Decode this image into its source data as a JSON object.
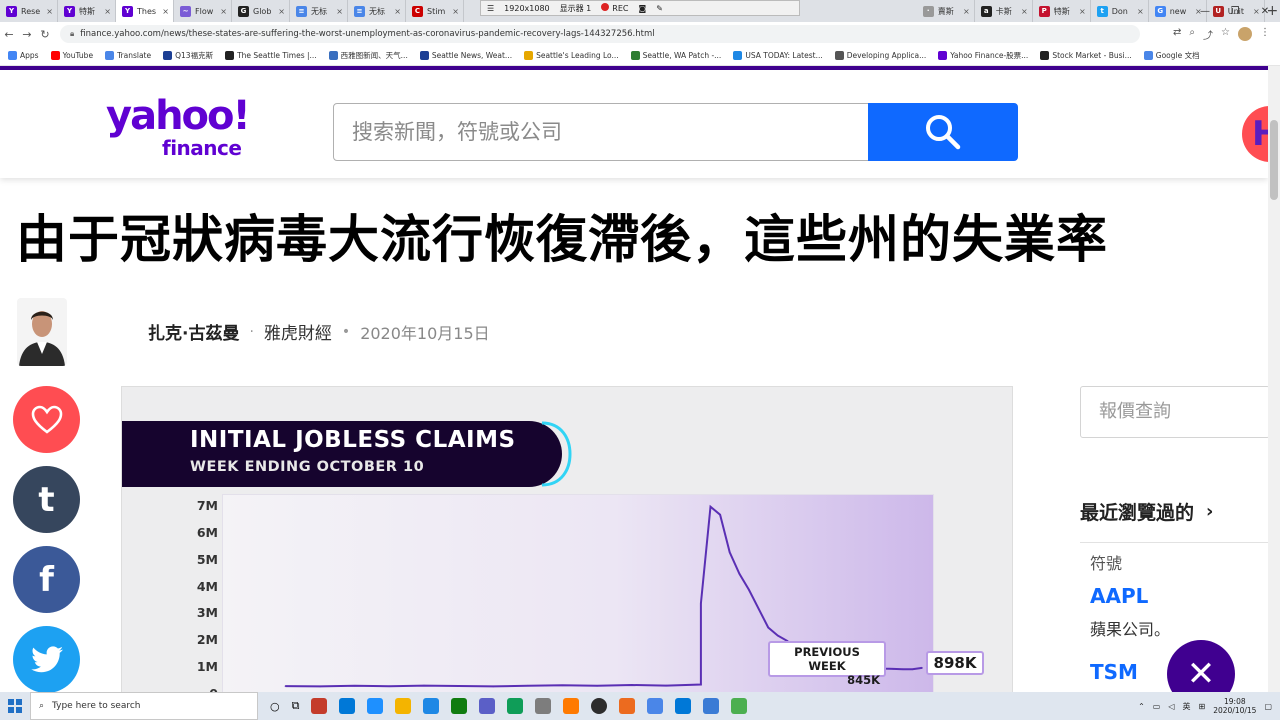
{
  "browser": {
    "tabs": [
      {
        "label": "Rese",
        "color": "#6001d2",
        "glyph": "Y",
        "active": false
      },
      {
        "label": "特斯",
        "color": "#6001d2",
        "glyph": "Y",
        "active": false
      },
      {
        "label": "Thes",
        "color": "#6001d2",
        "glyph": "Y",
        "active": true
      },
      {
        "label": "Flow",
        "color": "#7b5cd6",
        "glyph": "~",
        "active": false
      },
      {
        "label": "Glob",
        "color": "#222222",
        "glyph": "G",
        "active": false
      },
      {
        "label": "无标",
        "color": "#4a86e8",
        "glyph": "≡",
        "active": false
      },
      {
        "label": "无标",
        "color": "#4a86e8",
        "glyph": "≡",
        "active": false
      },
      {
        "label": "Stim",
        "color": "#cc0000",
        "glyph": "C",
        "active": false
      }
    ],
    "tabs_right": [
      {
        "label": "賣斯",
        "color": "#999999",
        "glyph": "·"
      },
      {
        "label": "卡斯",
        "color": "#222222",
        "glyph": "a"
      },
      {
        "label": "特斯",
        "color": "#c4122f",
        "glyph": "P"
      },
      {
        "label": "Don",
        "color": "#1da1f2",
        "glyph": "t"
      },
      {
        "label": "new",
        "color": "#4285f4",
        "glyph": "G"
      },
      {
        "label": "Unit",
        "color": "#b22222",
        "glyph": "U"
      }
    ],
    "recorder": {
      "resolution": "1920x1080",
      "display": "显示器 1",
      "rec_label": "REC"
    },
    "url": "finance.yahoo.com/news/these-states-are-suffering-the-worst-unemployment-as-coronavirus-pandemic-recovery-lags-144327256.html",
    "bookmarks": [
      {
        "label": "Apps",
        "color": "#4285f4"
      },
      {
        "label": "YouTube",
        "color": "#ff0000"
      },
      {
        "label": "Translate",
        "color": "#4a86e8"
      },
      {
        "label": "Q13福克斯",
        "color": "#1c3f94"
      },
      {
        "label": "The Seattle Times |...",
        "color": "#222222"
      },
      {
        "label": "西雅图新闻、天气...",
        "color": "#3a6fbf"
      },
      {
        "label": "Seattle News, Weat...",
        "color": "#1c3f94"
      },
      {
        "label": "Seattle's Leading Lo...",
        "color": "#e6a700"
      },
      {
        "label": "Seattle, WA Patch -...",
        "color": "#2e7d32"
      },
      {
        "label": "USA TODAY: Latest...",
        "color": "#1e88e5"
      },
      {
        "label": "Developing Applica...",
        "color": "#555555"
      },
      {
        "label": "Yahoo Finance-股票...",
        "color": "#6001d2"
      },
      {
        "label": "Stock Market - Busi...",
        "color": "#222222"
      },
      {
        "label": "Google 文档",
        "color": "#4a86e8"
      }
    ]
  },
  "site": {
    "logo_top": "yahoo!",
    "logo_bottom": "finance",
    "search_placeholder": "搜索新聞，符號或公司",
    "brand_color": "#6001d2",
    "search_button_color": "#0f69ff"
  },
  "article": {
    "headline": "由于冠狀病毒大流行恢復滯後，這些州的失業率",
    "author": "扎克·古茲曼",
    "source": "雅虎財經",
    "date": "2020年10月15日"
  },
  "share": {
    "heart_icon": "heart-icon",
    "tumblr_glyph": "t",
    "facebook_glyph": "f",
    "twitter_icon": "twitter-icon"
  },
  "video": {
    "title": "INITIAL JOBLESS CLAIMS",
    "subtitle": "WEEK ENDING OCTOBER 10",
    "previous_week_label": "PREVIOUS WEEK",
    "previous_week_value": "845K",
    "current_value": "898K"
  },
  "chart_data": {
    "type": "line",
    "title": "INITIAL JOBLESS CLAIMS",
    "subtitle": "WEEK ENDING OCTOBER 10",
    "y_ticks": [
      "7M",
      "6M",
      "5M",
      "4M",
      "3M",
      "2M",
      "1M",
      "0"
    ],
    "ylim": [
      0,
      7000000
    ],
    "series": [
      {
        "values": [
          220000,
          210000,
          230000,
          215000,
          240000,
          225000,
          210000,
          235000,
          250000,
          230000,
          260000,
          240000,
          280000,
          3300000,
          6900000,
          6600000,
          5200000,
          4400000,
          3800000,
          3100000,
          2400000,
          2100000,
          1900000,
          1500000,
          1300000,
          1100000,
          1250000,
          1400000,
          1300000,
          1100000,
          900000,
          1000000,
          870000,
          860000,
          850000,
          845000,
          898000
        ]
      }
    ],
    "annotations": [
      {
        "label": "PREVIOUS WEEK",
        "value": "845K"
      },
      {
        "label": "",
        "value": "898K"
      }
    ],
    "grid": false
  },
  "rail": {
    "quote_placeholder": "報價查詢",
    "recent_title": "最近瀏覽過的",
    "symbol_header": "符號",
    "tickers": [
      {
        "symbol": "AAPL",
        "name": "蘋果公司。"
      },
      {
        "symbol": "TSM",
        "name": ""
      }
    ]
  },
  "taskbar": {
    "search_placeholder": "Type here to search",
    "time": "19:08",
    "date": "2020/10/15",
    "lang": "英",
    "icons": [
      "#c43c2b",
      "#0078d7",
      "#1e90ff",
      "#f4b400",
      "#1e88e5",
      "#107c10",
      "#5b5fc7",
      "#0f9d58",
      "#7d7d7d",
      "#ff7a00",
      "#2d2d2d",
      "#ec6b1f",
      "#4a86e8",
      "#0078d7",
      "#3a7bd5",
      "#4caf50"
    ]
  }
}
